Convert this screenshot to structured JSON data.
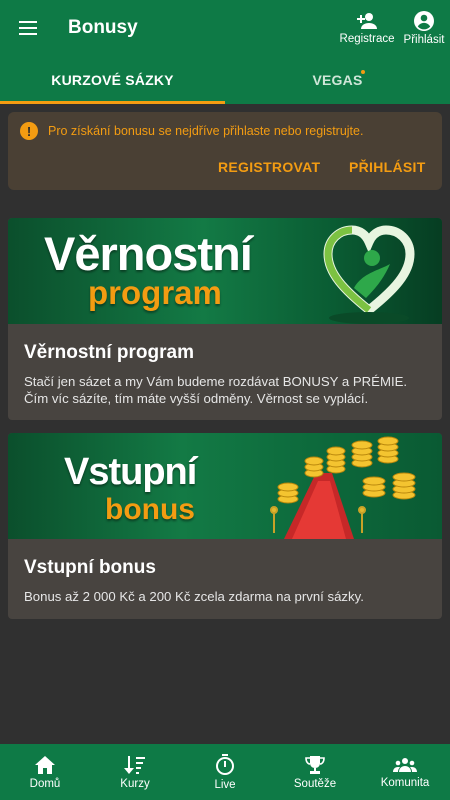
{
  "header": {
    "title": "Bonusy",
    "actions": [
      {
        "label": "Registrace",
        "icon": "person-add-icon"
      },
      {
        "label": "Přihlásit",
        "icon": "account-circle-icon"
      }
    ]
  },
  "tabs": [
    {
      "label": "KURZOVÉ SÁZKY",
      "active": true
    },
    {
      "label": "VEGAS",
      "active": false,
      "has_dot": true
    }
  ],
  "alert": {
    "icon": "exclamation-icon",
    "text": "Pro získání bonusu se nejdříve přihlaste nebo registrujte.",
    "register_label": "REGISTROVAT",
    "login_label": "PŘIHLÁSIT"
  },
  "cards": [
    {
      "banner_line1": "Věrnostní",
      "banner_line2": "program",
      "title": "Věrnostní program",
      "text": "Stačí jen sázet a my Vám budeme rozdávat BONUSY a PRÉMIE. Čím víc sázíte, tím máte vyšší odměny. Věrnost se vyplácí."
    },
    {
      "banner_line1": "Vstupní",
      "banner_line2": "bonus",
      "title": "Vstupní bonus",
      "text": "Bonus až 2 000 Kč a 200 Kč zcela zdarma na první sázky."
    }
  ],
  "bottom_nav": [
    {
      "label": "Domů",
      "icon": "home-icon"
    },
    {
      "label": "Kurzy",
      "icon": "odds-icon"
    },
    {
      "label": "Live",
      "icon": "stopwatch-icon"
    },
    {
      "label": "Soutěže",
      "icon": "trophy-icon"
    },
    {
      "label": "Komunita",
      "icon": "group-icon"
    }
  ],
  "colors": {
    "primary_green": "#0e7a46",
    "accent_orange": "#f39c12",
    "background": "#303030",
    "card": "#484440",
    "alert_bg": "#4a4034"
  }
}
